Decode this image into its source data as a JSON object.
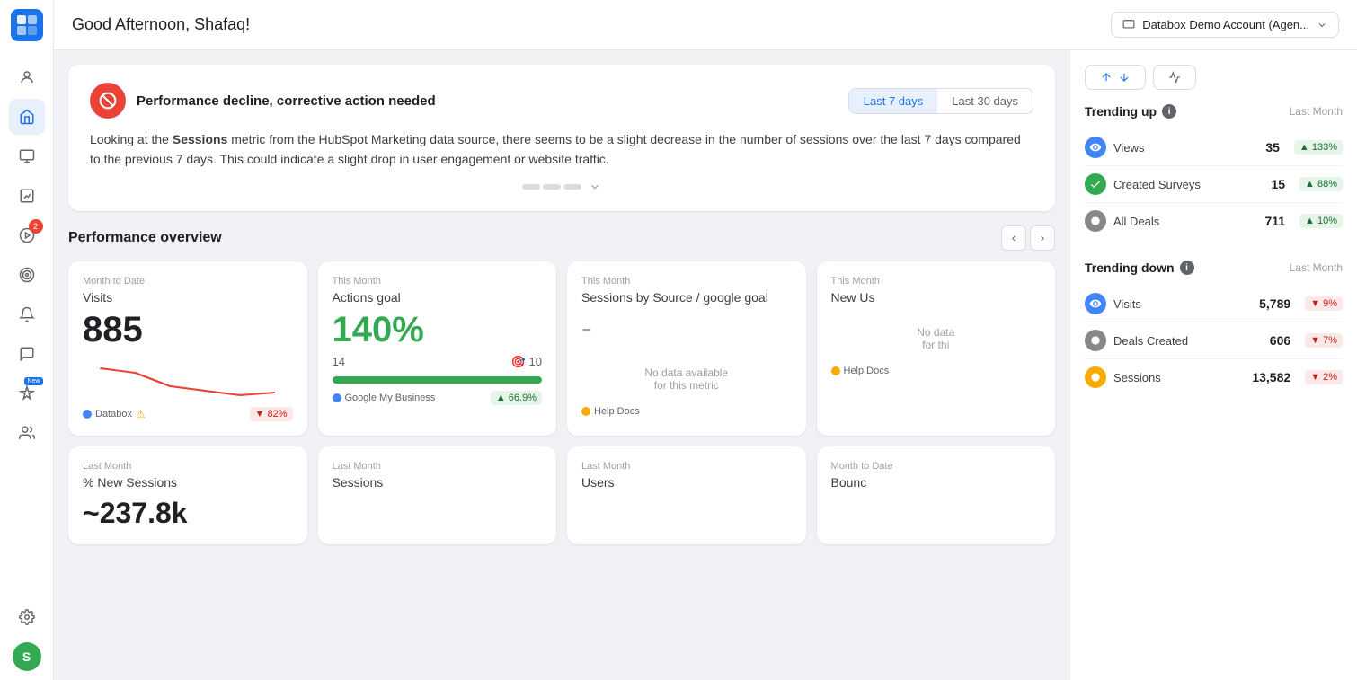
{
  "app": {
    "logo": "D",
    "greeting": "Good Afternoon, Shafaq!",
    "account": "Databox Demo Account (Agen...",
    "account_dropdown": true
  },
  "sidebar": {
    "items": [
      {
        "id": "people",
        "icon": "👤",
        "active": false
      },
      {
        "id": "home",
        "icon": "🏠",
        "active": true
      },
      {
        "id": "metrics",
        "icon": "🔢",
        "active": false
      },
      {
        "id": "chart",
        "icon": "📊",
        "active": false
      },
      {
        "id": "play",
        "icon": "▶",
        "active": false,
        "badge": "2"
      },
      {
        "id": "goals",
        "icon": "🎯",
        "active": false
      },
      {
        "id": "alerts",
        "icon": "🔔",
        "active": false
      },
      {
        "id": "chat",
        "icon": "💬",
        "active": false
      },
      {
        "id": "ai",
        "icon": "✨",
        "active": false,
        "badge_new": "New"
      },
      {
        "id": "team",
        "icon": "👥",
        "active": false
      }
    ],
    "bottom": [
      {
        "id": "settings",
        "icon": "⚙"
      },
      {
        "id": "user",
        "avatar": "S"
      }
    ]
  },
  "top_actions": {
    "trending_label": "↑↓",
    "pulse_label": "⚡"
  },
  "alert": {
    "icon": "⊘",
    "title": "Performance decline, corrective action needed",
    "tab_active": "Last 7 days",
    "tab_inactive": "Last 30 days",
    "body_prefix": "Looking at the ",
    "body_metric": "Sessions",
    "body_suffix": " metric from the HubSpot Marketing data source, there seems to be a slight decrease in the number of sessions over the last 7 days compared to the previous 7 days. This could indicate a slight drop in user engagement or website traffic."
  },
  "performance_overview": {
    "title": "Performance overview",
    "metrics": [
      {
        "period": "Month to Date",
        "name": "Visits",
        "value": "885",
        "value_type": "normal",
        "has_sparkline": true,
        "source": "Databox",
        "source_color": "#4285f4",
        "has_warning": true,
        "badge": "▼ 82%",
        "badge_type": "down"
      },
      {
        "period": "This Month",
        "name": "Actions goal",
        "value": "140%",
        "value_type": "green",
        "current": "14",
        "target_icon": "🎯",
        "target": "10",
        "progress_pct": 100,
        "source": "Google My Business",
        "source_color": "#4285f4",
        "badge": "▲ 66.9%",
        "badge_type": "up"
      },
      {
        "period": "This Month",
        "name": "Sessions by Source / google goal",
        "value": "-",
        "value_type": "dash",
        "no_data": "No data available\nfor this metric",
        "source": "Help Docs",
        "source_color": "#f9ab00",
        "badge": "",
        "badge_type": ""
      },
      {
        "period": "This Month",
        "name": "New Us",
        "value": "",
        "value_type": "no_data",
        "no_data": "No data\nfor thi",
        "source": "Help Docs",
        "source_color": "#f9ab00",
        "badge": "",
        "badge_type": ""
      }
    ],
    "bottom_metrics": [
      {
        "period": "Last Month",
        "name": "% New Sessions",
        "value": "~237.8k",
        "value_type": "normal"
      },
      {
        "period": "Last Month",
        "name": "Sessions",
        "value": "",
        "value_type": "normal"
      },
      {
        "period": "Last Month",
        "name": "Users",
        "value": "",
        "value_type": "normal"
      },
      {
        "period": "Month to Date",
        "name": "Bounc",
        "value": "",
        "value_type": "normal"
      }
    ]
  },
  "trending_up": {
    "title": "Trending up",
    "period": "Last Month",
    "items": [
      {
        "name": "Views",
        "icon_bg": "#4285f4",
        "icon_text": "V",
        "value": "35",
        "badge": "▲ 133%",
        "badge_type": "up"
      },
      {
        "name": "Created Surveys",
        "icon_bg": "#34a853",
        "icon_text": "S",
        "value": "15",
        "badge": "▲ 88%",
        "badge_type": "up"
      },
      {
        "name": "All Deals",
        "icon_bg": "#666",
        "icon_text": "D",
        "value": "711",
        "badge": "▲ 10%",
        "badge_type": "up"
      }
    ]
  },
  "trending_down": {
    "title": "Trending down",
    "period": "Last Month",
    "items": [
      {
        "name": "Visits",
        "icon_bg": "#4285f4",
        "icon_text": "V",
        "value": "5,789",
        "badge": "▼ 9%",
        "badge_type": "down"
      },
      {
        "name": "Deals Created",
        "icon_bg": "#666",
        "icon_text": "D",
        "value": "606",
        "badge": "▼ 7%",
        "badge_type": "down"
      },
      {
        "name": "Sessions",
        "icon_bg": "#f9ab00",
        "icon_text": "S",
        "value": "13,582",
        "badge": "▼ 2%",
        "badge_type": "down"
      }
    ]
  }
}
